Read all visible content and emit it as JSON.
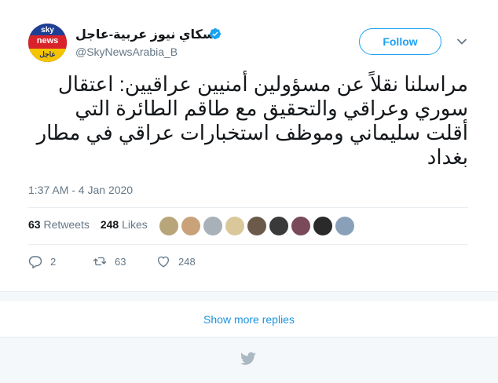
{
  "account": {
    "display_name": "سكاي نيوز عربية-عاجل",
    "handle": "@SkyNewsArabia_B",
    "avatar_text_1": "sky",
    "avatar_text_2": "news",
    "avatar_text_3": "عاجل",
    "verified_icon": "verified-badge-icon"
  },
  "follow_button": {
    "label": "Follow"
  },
  "tweet": {
    "text": "مراسلنا نقلاً عن مسؤولين أمنيين عراقيين: اعتقال سوري وعراقي والتحقيق مع طاقم الطائرة التي أقلت سليماني وموظف استخبارات عراقي في مطار بغداد",
    "timestamp": "1:37 AM - 4 Jan 2020"
  },
  "stats": {
    "retweets_count": "63",
    "retweets_label": "Retweets",
    "likes_count": "248",
    "likes_label": "Likes"
  },
  "likers": [
    {
      "color": "#b8a57a"
    },
    {
      "color": "#c9a27a"
    },
    {
      "color": "#a8b0b8"
    },
    {
      "color": "#d9c89a"
    },
    {
      "color": "#6b5a4a"
    },
    {
      "color": "#3a3a3a"
    },
    {
      "color": "#7a4a5a"
    },
    {
      "color": "#2a2a2a"
    },
    {
      "color": "#8aa0b8"
    }
  ],
  "actions": {
    "reply_count": "2",
    "retweet_count": "63",
    "like_count": "248"
  },
  "show_more_replies": "Show more replies",
  "colors": {
    "accent": "#1da1f2",
    "link": "#1b95e0",
    "muted": "#657786"
  }
}
